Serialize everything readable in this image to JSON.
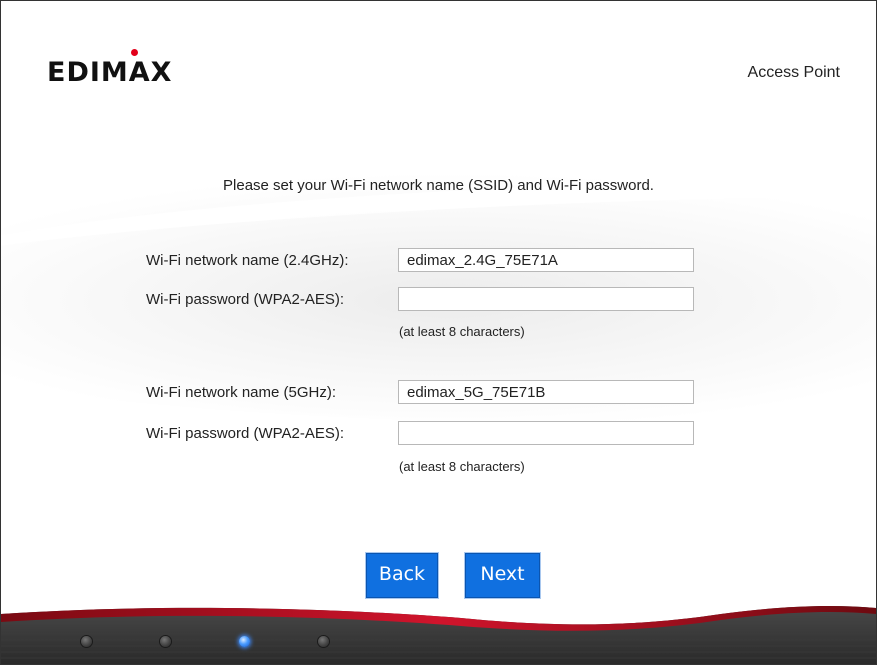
{
  "header": {
    "logo": "EDIMAX",
    "product": "Access Point"
  },
  "instruction": "Please set your Wi-Fi network name (SSID) and Wi-Fi password.",
  "band_24": {
    "ssid_label": "Wi-Fi network name (2.4GHz):",
    "ssid_value": "edimax_2.4G_75E71A",
    "password_label": "Wi-Fi password (WPA2-AES):",
    "password_value": "",
    "hint": "(at least 8 characters)"
  },
  "band_5": {
    "ssid_label": "Wi-Fi network name (5GHz):",
    "ssid_value": "edimax_5G_75E71B",
    "password_label": "Wi-Fi password (WPA2-AES):",
    "password_value": "",
    "hint": "(at least 8 characters)"
  },
  "buttons": {
    "back": "Back",
    "next": "Next"
  },
  "progress": {
    "total_steps": 4,
    "current_step": 3
  },
  "colors": {
    "accent": "#1070e0",
    "brand_red": "#c8102e",
    "active_step": "#3f8cff"
  }
}
